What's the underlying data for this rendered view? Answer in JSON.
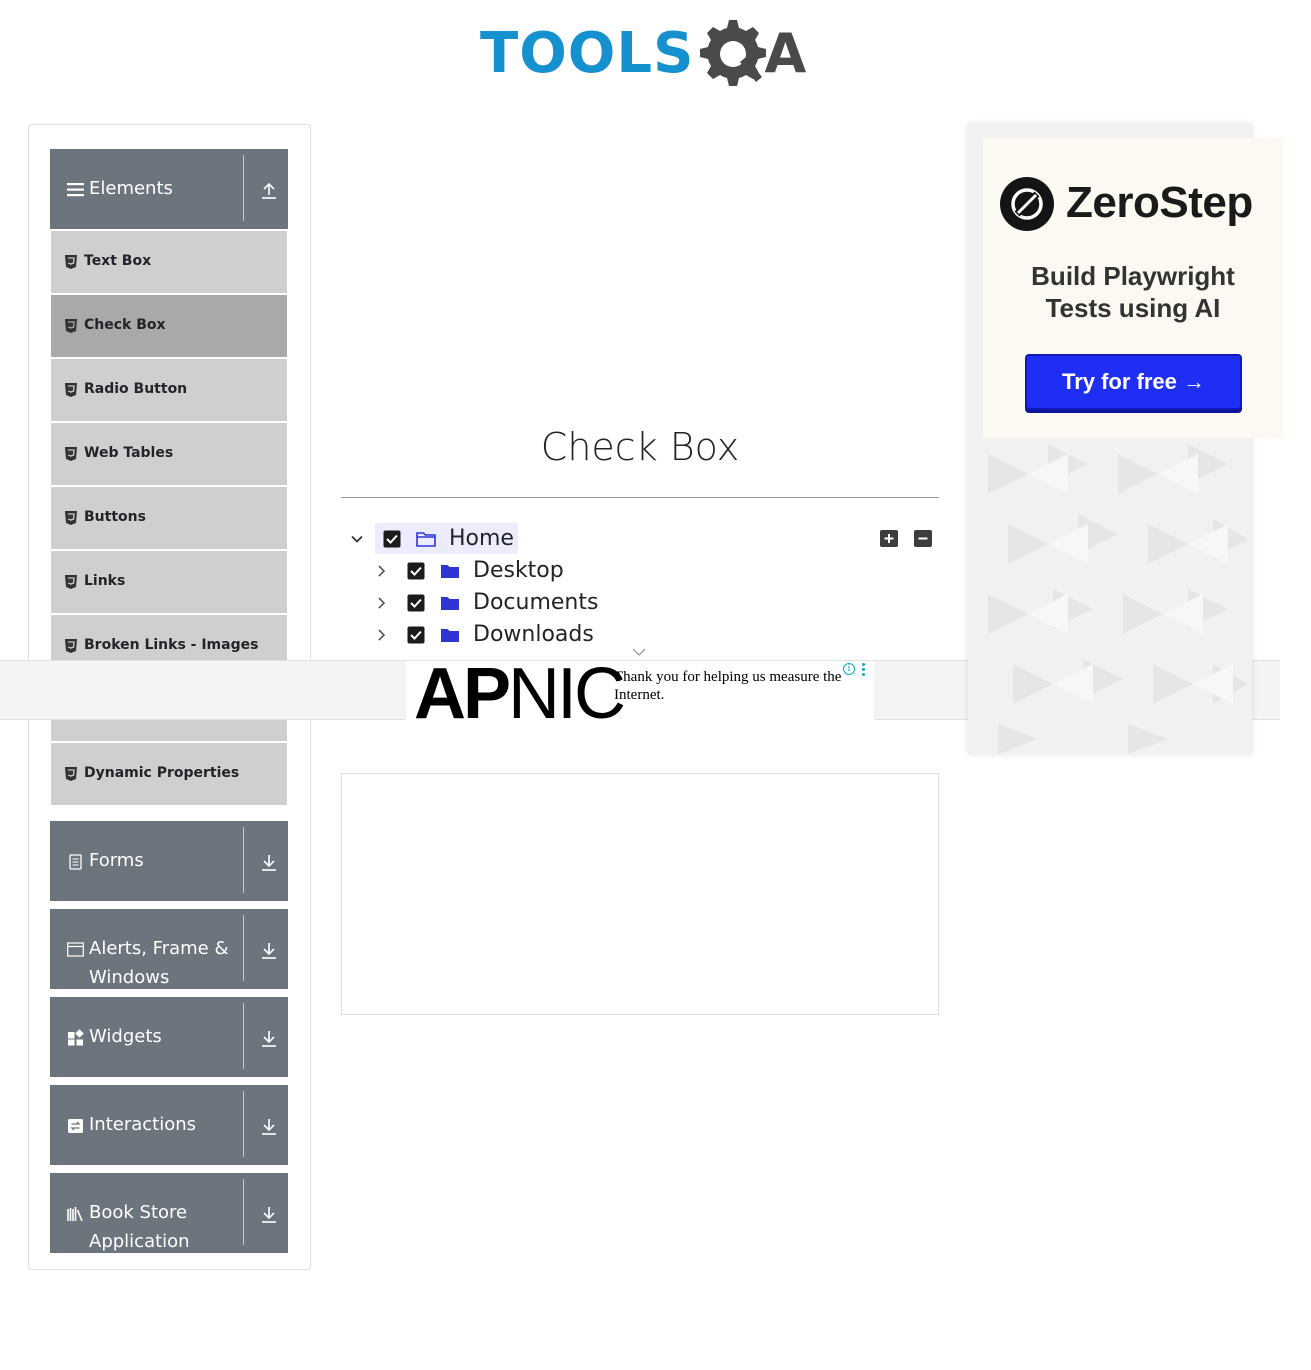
{
  "header": {
    "logo_tools": "TOOLS",
    "logo_a": "A"
  },
  "sidebar": {
    "groups": [
      {
        "title": "Elements",
        "icon": "hamburger-icon",
        "arrow": "upload-arrow-icon"
      },
      {
        "title": "Forms",
        "icon": "document-icon",
        "arrow": "download-arrow-icon"
      },
      {
        "title": "Alerts, Frame &",
        "title2": "Windows",
        "icon": "window-icon",
        "arrow": "download-arrow-icon"
      },
      {
        "title": "Widgets",
        "icon": "widgets-icon",
        "arrow": "download-arrow-icon"
      },
      {
        "title": "Interactions",
        "icon": "interactions-icon",
        "arrow": "download-arrow-icon"
      },
      {
        "title": "Book Store",
        "title2": "Application",
        "icon": "books-icon",
        "arrow": "download-arrow-icon"
      }
    ],
    "items": [
      {
        "label": "Text Box"
      },
      {
        "label": "Check Box",
        "active": true
      },
      {
        "label": "Radio Button"
      },
      {
        "label": "Web Tables"
      },
      {
        "label": "Buttons"
      },
      {
        "label": "Links"
      },
      {
        "label": "Broken Links - Images"
      },
      {
        "label": "Dynamic Properties"
      }
    ]
  },
  "main": {
    "title": "Check Box",
    "tree": [
      {
        "label": "Home",
        "expanded": true,
        "checked": true
      },
      {
        "label": "Desktop",
        "expanded": false,
        "checked": true
      },
      {
        "label": "Documents",
        "expanded": false,
        "checked": true
      },
      {
        "label": "Downloads",
        "expanded": false,
        "checked": true
      }
    ],
    "expand_all_icon": "plus-square-icon",
    "collapse_all_icon": "minus-square-icon"
  },
  "banner_ad": {
    "brand_bold": "AP",
    "brand_light": "NIC",
    "text": "Thank you for helping us measure the Internet.",
    "info_icon": "info-icon",
    "menu_icon": "kebab-menu-icon"
  },
  "side_ad": {
    "brand": "ZeroStep",
    "tagline_1": "Build Playwright",
    "tagline_2": "Tests using AI",
    "cta": "Try for free →"
  },
  "colors": {
    "logo_blue": "#1591d0",
    "group_header": "#6c757d",
    "menu_item": "#cfcfcf",
    "menu_item_active": "#a9a9a9",
    "folder_blue": "#3034d4",
    "cta_blue": "#1e2ef5"
  }
}
